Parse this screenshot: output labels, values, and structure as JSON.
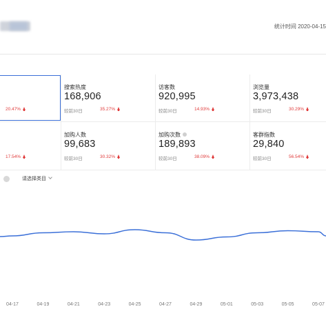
{
  "header": {
    "stat_time": "统计时间 2020-04-15"
  },
  "cards": [
    {
      "label": "",
      "value": "",
      "compare": "",
      "pct": "20.47%"
    },
    {
      "label": "搜索热度",
      "value": "168,906",
      "compare": "较前30日",
      "pct": "35.27%"
    },
    {
      "label": "访客数",
      "value": "920,995",
      "compare": "较前30日",
      "pct": "14.93%"
    },
    {
      "label": "浏览量",
      "value": "3,973,438",
      "compare": "较前30日",
      "pct": "30.29%"
    },
    {
      "label": "",
      "value": "",
      "compare": "",
      "pct": "17.54%"
    },
    {
      "label": "加购人数",
      "value": "99,683",
      "compare": "较前30日",
      "pct": "30.32%"
    },
    {
      "label": "加购次数",
      "value": "189,893",
      "compare": "较前30日",
      "pct": "38.09%"
    },
    {
      "label": "客群指数",
      "value": "29,840",
      "compare": "较前30日",
      "pct": "56.54%"
    }
  ],
  "filter": {
    "select_label": "请选择类目"
  },
  "colors": {
    "accent": "#3a6fd8",
    "up": "#e03c3c",
    "line": "#3a6fd8"
  },
  "chart_data": {
    "type": "line",
    "x": [
      "04-17",
      "04-19",
      "04-21",
      "04-23",
      "04-25",
      "04-27",
      "04-29",
      "05-01",
      "05-03",
      "05-05",
      "05-07"
    ],
    "series": [
      {
        "values": [
          52,
          55,
          56,
          54,
          58,
          55,
          48,
          51,
          55,
          57,
          56
        ]
      }
    ],
    "ylim": [
      0,
      100
    ],
    "grid": false
  }
}
